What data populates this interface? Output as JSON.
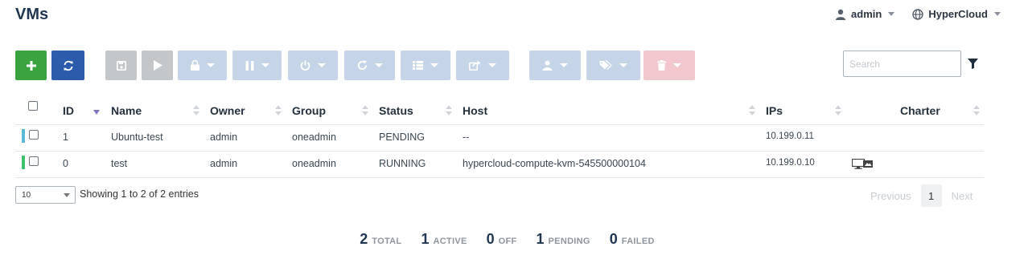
{
  "page": {
    "title": "VMs"
  },
  "user_menu": {
    "user": "admin",
    "zone": "HyperCloud"
  },
  "search": {
    "placeholder": "Search"
  },
  "columns": {
    "id": "ID",
    "name": "Name",
    "owner": "Owner",
    "group": "Group",
    "status": "Status",
    "host": "Host",
    "ips": "IPs",
    "charter": "Charter"
  },
  "rows": [
    {
      "id": "1",
      "name": "Ubuntu-test",
      "owner": "admin",
      "group": "oneadmin",
      "status": "PENDING",
      "host": "--",
      "ips": "10.199.0.11",
      "status_color": "#5bb8d6",
      "vnc": false
    },
    {
      "id": "0",
      "name": "test",
      "owner": "admin",
      "group": "oneadmin",
      "status": "RUNNING",
      "host": "hypercloud-compute-kvm-545500000104",
      "ips": "10.199.0.10",
      "status_color": "#3cc36c",
      "vnc": true
    }
  ],
  "table_footer": {
    "page_length": "10",
    "info": "Showing 1 to 2 of 2 entries",
    "previous": "Previous",
    "page": "1",
    "next": "Next"
  },
  "summary": [
    {
      "value": "2",
      "label": "TOTAL"
    },
    {
      "value": "1",
      "label": "ACTIVE"
    },
    {
      "value": "0",
      "label": "OFF"
    },
    {
      "value": "1",
      "label": "PENDING"
    },
    {
      "value": "0",
      "label": "FAILED"
    }
  ],
  "colors": {
    "create": "#3aa340",
    "refresh": "#2d5bab",
    "disabled_gray": "#c4c7ca",
    "disabled_blue": "#c5d4e7",
    "disabled_red": "#f2c7cd",
    "title": "#1f3550"
  },
  "icons": {
    "create": "plus-icon",
    "refresh": "refresh-icon",
    "save": "save-icon",
    "play": "play-icon",
    "lock": "lock-icon",
    "pause": "pause-icon",
    "power": "power-icon",
    "reboot": "reboot-icon",
    "list": "list-icon",
    "share": "share-icon",
    "user": "user-icon",
    "tags": "tags-icon",
    "delete": "trash-icon",
    "filter": "filter-icon",
    "vnc": "vnc-icon"
  }
}
